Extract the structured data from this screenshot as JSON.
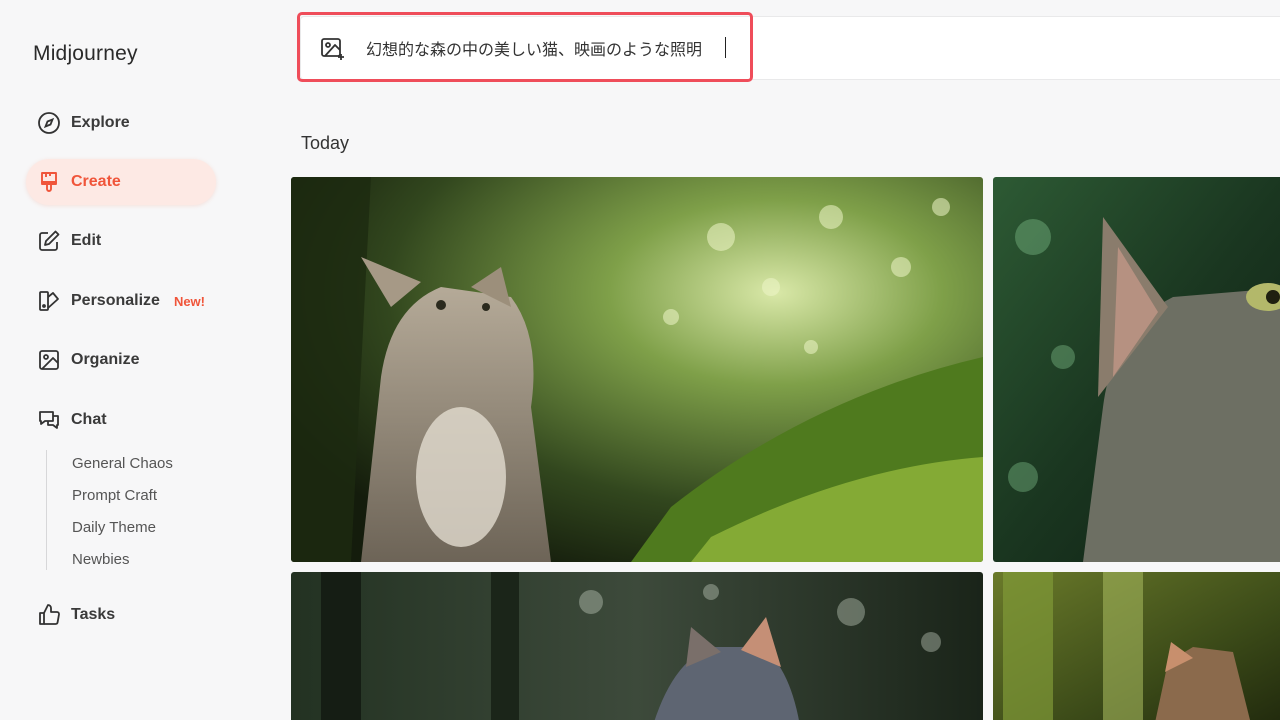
{
  "brand": "Midjourney",
  "nav": {
    "explore": "Explore",
    "create": "Create",
    "edit": "Edit",
    "personalize": "Personalize",
    "personalize_badge": "New!",
    "organize": "Organize",
    "chat": "Chat",
    "tasks": "Tasks"
  },
  "chat_channels": [
    "General Chaos",
    "Prompt Craft",
    "Daily Theme",
    "Newbies"
  ],
  "prompt": {
    "value": "幻想的な森の中の美しい猫、映画のような照明"
  },
  "section_title": "Today",
  "colors": {
    "accent": "#f0553a",
    "active_bg": "#fde9e4",
    "highlight_border": "#ef4d5a"
  },
  "gallery": {
    "images": [
      "cat-in-forest-looking-up",
      "cat-closeup-green-bokeh",
      "gray-cat-dark-forest",
      "cat-mossy-forest"
    ]
  }
}
